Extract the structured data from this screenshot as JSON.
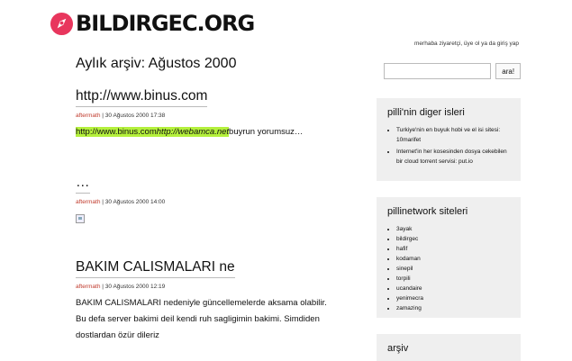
{
  "site": {
    "logo_text": "BILDIRGEC.ORG",
    "brand_color": "#e8365d",
    "greeting": "merhaba ziyaretçi, üye ol ya da giriş yap"
  },
  "archive": {
    "title": "Aylık arşiv: Ağustos 2000"
  },
  "posts": [
    {
      "title": "http://www.binus.com",
      "author": "aftermath",
      "date": "30 Ağustos 2000 17:38",
      "body": {
        "link1": "http://www.binus.com",
        "link2": "http://webamca.net",
        "rest": "buyrun yorumsuz…"
      }
    },
    {
      "title": "…",
      "author": "aftermath",
      "date": "30 Ağustos 2000 14:00"
    },
    {
      "title": "BAKIM CALISMALARI ne",
      "author": "aftermath",
      "date": "30 Ağustos 2000 12:19",
      "body_lines": [
        "BAKIM CALISMALARI nedeniyle güncellemelerde aksama olabilir.",
        "Bu defa server bakimi deil kendi ruh sagligimin bakimi. Simdiden",
        "dostlardan özür dileriz"
      ]
    }
  ],
  "search": {
    "placeholder": "",
    "button_label": "ara!"
  },
  "sidebar": {
    "widget1": {
      "title": "pilli'nin diger isleri",
      "items": [
        "Turkiye'nin en buyuk hobi ve el isi sitesi: 10marifet",
        "Internet'in her kosesinden dosya cekebilen bir cloud torrent servisi: put.io"
      ]
    },
    "widget2": {
      "title": "pillinetwork siteleri",
      "items": [
        "3ayak",
        "bildirgec",
        "hafif",
        "kodaman",
        "sinepil",
        "torpili",
        "ucandaire",
        "yenimecra",
        "zamazing"
      ]
    },
    "widget3": {
      "title": "arşiv"
    }
  },
  "meta_separator": "|"
}
